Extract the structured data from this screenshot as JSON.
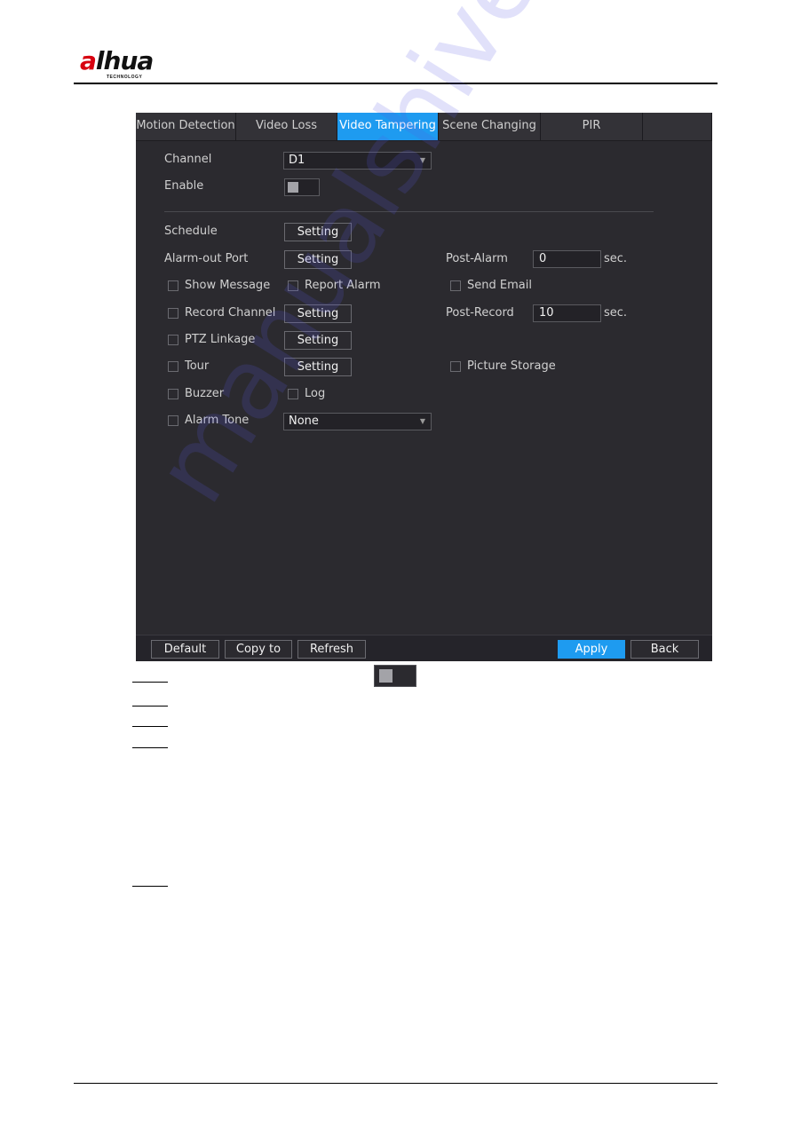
{
  "document": {
    "brand_logo": {
      "main": "alhua",
      "accent_letter": "a",
      "rest": "lhua",
      "tagline": "TECHNOLOGY"
    },
    "watermark": "manualshive.com"
  },
  "panel": {
    "tabs": [
      {
        "label": "Motion Detection",
        "active": false
      },
      {
        "label": "Video Loss",
        "active": false
      },
      {
        "label": "Video Tampering",
        "active": true
      },
      {
        "label": "Scene Changing",
        "active": false
      },
      {
        "label": "PIR",
        "active": false
      },
      {
        "label": "",
        "active": false
      }
    ],
    "channel": {
      "label": "Channel",
      "value": "D1"
    },
    "enable": {
      "label": "Enable",
      "on": false
    },
    "schedule": {
      "label": "Schedule",
      "button": "Setting"
    },
    "alarm_out_port": {
      "label": "Alarm-out Port",
      "button": "Setting"
    },
    "post_alarm": {
      "label": "Post-Alarm",
      "value": "0",
      "unit": "sec."
    },
    "show_message": {
      "label": "Show Message",
      "checked": false
    },
    "report_alarm": {
      "label": "Report Alarm",
      "checked": false
    },
    "send_email": {
      "label": "Send Email",
      "checked": false
    },
    "record_channel": {
      "label": "Record Channel",
      "checked": false,
      "button": "Setting"
    },
    "post_record": {
      "label": "Post-Record",
      "value": "10",
      "unit": "sec."
    },
    "ptz_linkage": {
      "label": "PTZ Linkage",
      "checked": false,
      "button": "Setting"
    },
    "tour": {
      "label": "Tour",
      "checked": false,
      "button": "Setting"
    },
    "picture_storage": {
      "label": "Picture Storage",
      "checked": false
    },
    "buzzer": {
      "label": "Buzzer",
      "checked": false
    },
    "log": {
      "label": "Log",
      "checked": false
    },
    "alarm_tone": {
      "label": "Alarm Tone",
      "checked": false,
      "value": "None"
    },
    "footer": {
      "default": "Default",
      "copy_to": "Copy to",
      "refresh": "Refresh",
      "apply": "Apply",
      "back": "Back"
    },
    "colors": {
      "accent": "#1e9bf0",
      "background": "#2b2a2f"
    }
  }
}
